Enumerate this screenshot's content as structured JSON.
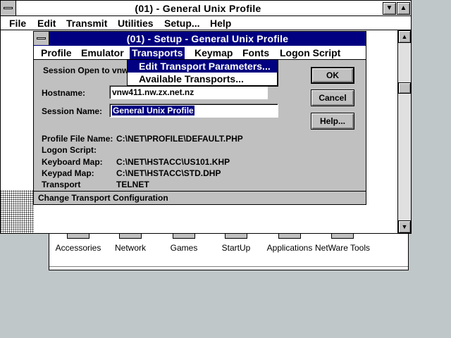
{
  "main_window": {
    "title": "(01) - General Unix Profile",
    "menu": [
      "File",
      "Edit",
      "Transmit",
      "Utilities",
      "Setup...",
      "Help"
    ]
  },
  "program_groups": [
    "Accessories",
    "Network",
    "Games",
    "StartUp",
    "Applications",
    "NetWare Tools"
  ],
  "dialog": {
    "title": "(01) - Setup - General Unix Profile",
    "menu": [
      "Profile",
      "Emulator",
      "Transports",
      "Keymap",
      "Fonts",
      "Logon Script"
    ],
    "active_menu": "Transports",
    "session_open_text": "Session Open to vnw",
    "hostname_label": "Hostname:",
    "hostname_value": "vnw411.nw.zx.net.nz",
    "session_name_label": "Session Name:",
    "session_name_value": "General Unix Profile",
    "info": [
      {
        "label": "Profile File Name:",
        "value": "C:\\NET\\PROFILE\\DEFAULT.PHP"
      },
      {
        "label": "Logon Script:",
        "value": ""
      },
      {
        "label": "Keyboard Map:",
        "value": "C:\\NET\\HSTACC\\US101.KHP"
      },
      {
        "label": "Keypad Map:",
        "value": "C:\\NET\\HSTACC\\STD.DHP"
      },
      {
        "label": "Transport",
        "value": "TELNET"
      }
    ],
    "buttons": {
      "ok": "OK",
      "cancel": "Cancel",
      "help": "Help..."
    },
    "status": "Change Transport Configuration"
  },
  "dropdown": {
    "items": [
      "Edit Transport Parameters...",
      "Available Transports..."
    ],
    "highlighted": 0
  },
  "colors": {
    "desktop": "#c0c7c8",
    "title_active": "#000080",
    "face": "#c0c0c0"
  }
}
